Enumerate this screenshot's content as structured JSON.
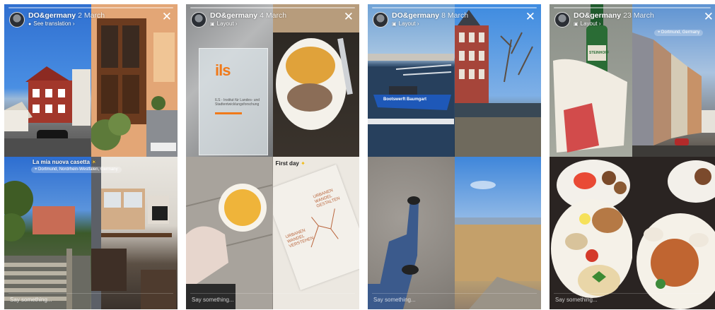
{
  "stories": [
    {
      "user": "DO&germany",
      "date": "2 March",
      "subtitle": "See translation",
      "subtitle_icon": "globe-icon",
      "footer_placeholder": "Say something...",
      "caption": "La mia nuova casetta",
      "caption_emoji": "☀",
      "location": "Dortmund, Nordrhein-Westfalen, Germany"
    },
    {
      "user": "DO&germany",
      "date": "4 March",
      "subtitle": "Layout",
      "subtitle_icon": "layout-icon",
      "footer_placeholder": "Say something...",
      "sign_logo": "ils",
      "sign_text": "ILS - Institut für Landes- und Stadtentwicklungsforschung",
      "caption": "First day",
      "book_lines": [
        "URBANEN",
        "WANDEL",
        "VERSTEHEN"
      ],
      "book_lines_2": [
        "URBANEN",
        "WANDEL",
        "GESTALTEN"
      ]
    },
    {
      "user": "DO&germany",
      "date": "8 March",
      "subtitle": "Layout",
      "subtitle_icon": "layout-icon",
      "footer_placeholder": "Say something...",
      "boat_text": "Bootswerft Baumgart"
    },
    {
      "user": "DO&germany",
      "date": "23 March",
      "subtitle": "Layout",
      "subtitle_icon": "layout-icon",
      "footer_placeholder": "Say something...",
      "location": "Dortmund, Germany",
      "bottle_label": "STEINHOFF"
    }
  ],
  "colors": {
    "sky": "#3a7fd6",
    "dark": "#1e2228"
  }
}
